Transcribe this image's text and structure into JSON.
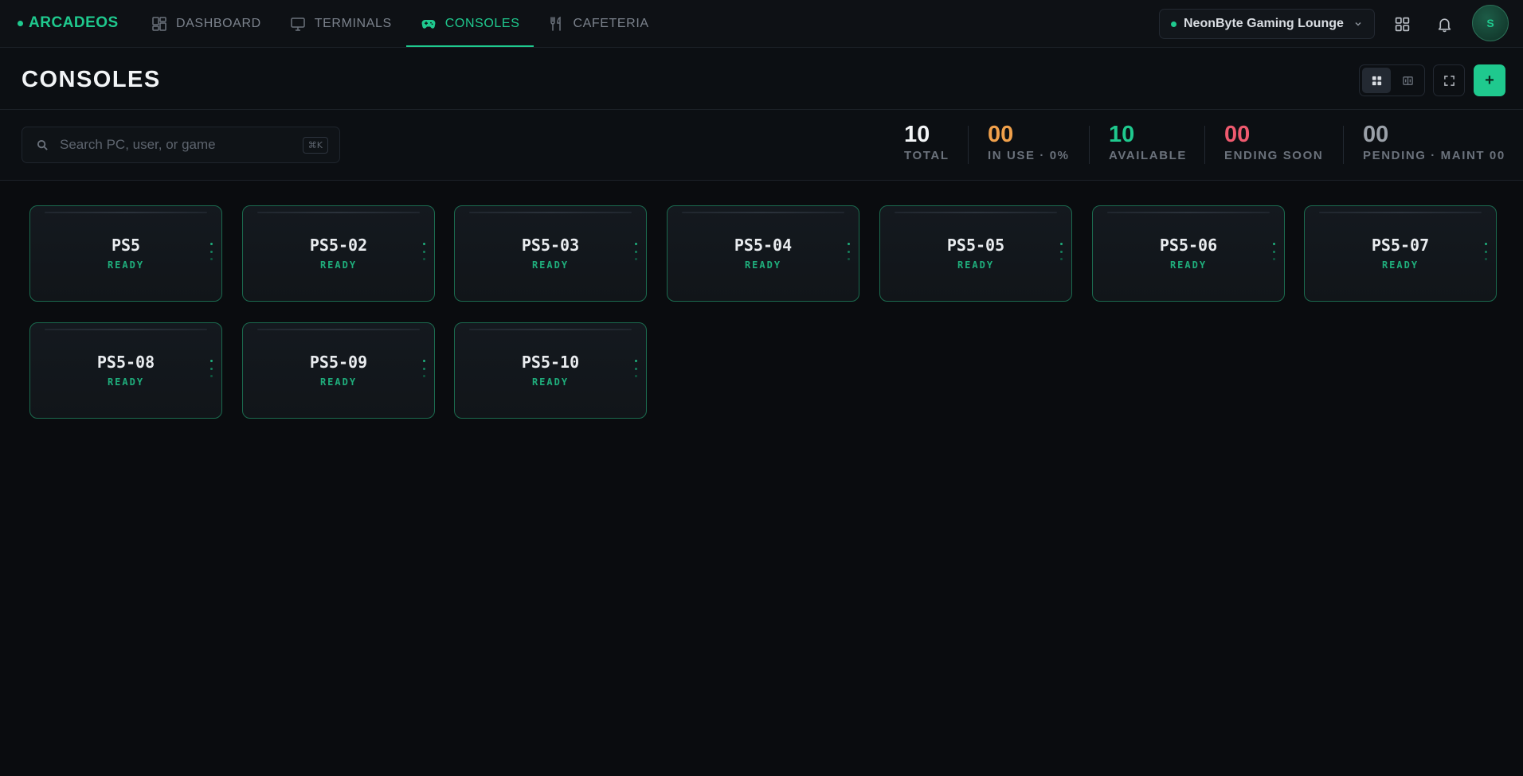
{
  "nav": {
    "brand": "ARCADEOS",
    "tabs": [
      {
        "label": "DASHBOARD",
        "icon": "dashboard-icon",
        "active": false
      },
      {
        "label": "TERMINALS",
        "icon": "monitor-icon",
        "active": false
      },
      {
        "label": "CONSOLES",
        "icon": "gamepad-icon",
        "active": true
      },
      {
        "label": "CAFETERIA",
        "icon": "utensils-icon",
        "active": false
      }
    ],
    "venue": "NeonByte Gaming Lounge",
    "avatar_initial": "S"
  },
  "header": {
    "title": "CONSOLES",
    "add_label": "+"
  },
  "search": {
    "placeholder": "Search PC, user, or game",
    "shortcut": "⌘K"
  },
  "stats": {
    "total": {
      "value": "10",
      "label": "TOTAL"
    },
    "in_use": {
      "value": "00",
      "label": "IN USE · 0%"
    },
    "available": {
      "value": "10",
      "label": "AVAILABLE"
    },
    "ending_soon": {
      "value": "00",
      "label": "ENDING SOON"
    },
    "pending": {
      "value": "00",
      "label": "PENDING · MAINT 00"
    }
  },
  "consoles": [
    {
      "name": "PS5",
      "status": "READY"
    },
    {
      "name": "PS5-02",
      "status": "READY"
    },
    {
      "name": "PS5-03",
      "status": "READY"
    },
    {
      "name": "PS5-04",
      "status": "READY"
    },
    {
      "name": "PS5-05",
      "status": "READY"
    },
    {
      "name": "PS5-06",
      "status": "READY"
    },
    {
      "name": "PS5-07",
      "status": "READY"
    },
    {
      "name": "PS5-08",
      "status": "READY"
    },
    {
      "name": "PS5-09",
      "status": "READY"
    },
    {
      "name": "PS5-10",
      "status": "READY"
    }
  ],
  "colors": {
    "accent": "#1fc98e",
    "in_use": "#f0a04b",
    "ending_soon": "#ef5a6f",
    "pending": "#9aa0a8",
    "total": "#f2f4f6"
  }
}
